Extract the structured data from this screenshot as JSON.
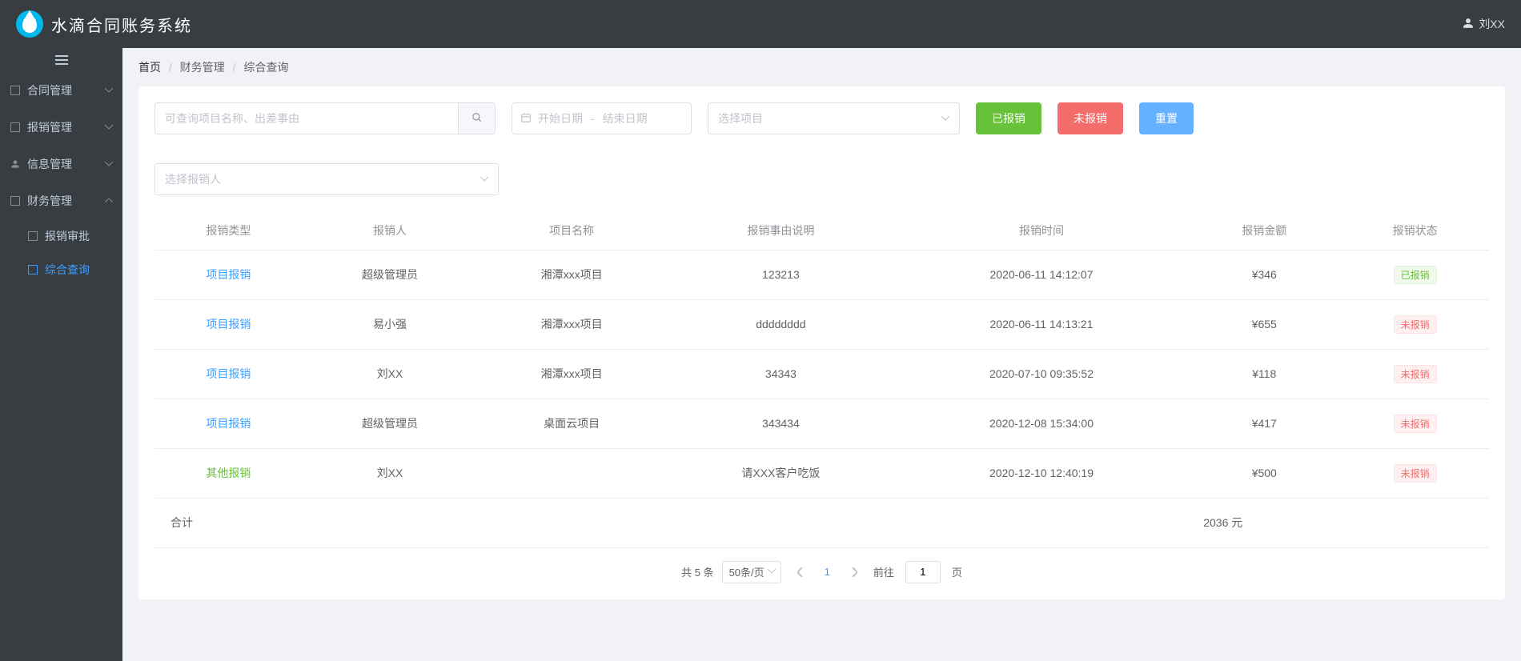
{
  "header": {
    "appTitle": "水滴合同账务系统",
    "userName": "刘XX"
  },
  "sidebar": {
    "items": [
      {
        "label": "合同管理"
      },
      {
        "label": "报销管理"
      },
      {
        "label": "信息管理"
      },
      {
        "label": "财务管理"
      }
    ],
    "subItems": [
      {
        "label": "报销审批"
      },
      {
        "label": "综合查询"
      }
    ]
  },
  "breadcrumb": {
    "home": "首页",
    "mid": "财务管理",
    "last": "综合查询"
  },
  "filters": {
    "searchPlaceholder": "可查询项目名称、出差事由",
    "dateStart": "开始日期",
    "dateEnd": "结束日期",
    "projectPlaceholder": "选择项目",
    "reporterPlaceholder": "选择报销人",
    "btnReported": "已报销",
    "btnUnreported": "未报销",
    "btnReset": "重置"
  },
  "table": {
    "headers": [
      "报销类型",
      "报销人",
      "项目名称",
      "报销事由说明",
      "报销时间",
      "报销金额",
      "报销状态"
    ],
    "rows": [
      {
        "type": "项目报销",
        "typeClass": "link-blue",
        "person": "超级管理员",
        "project": "湘潭xxx项目",
        "reason": "123213",
        "time": "2020-06-11 14:12:07",
        "amount": "¥346",
        "status": "已报销",
        "statusClass": "tag-green"
      },
      {
        "type": "项目报销",
        "typeClass": "link-blue",
        "person": "易小强",
        "project": "湘潭xxx项目",
        "reason": "dddddddd",
        "time": "2020-06-11 14:13:21",
        "amount": "¥655",
        "status": "未报销",
        "statusClass": "tag-red"
      },
      {
        "type": "项目报销",
        "typeClass": "link-blue",
        "person": "刘XX",
        "project": "湘潭xxx项目",
        "reason": "34343",
        "time": "2020-07-10 09:35:52",
        "amount": "¥118",
        "status": "未报销",
        "statusClass": "tag-red"
      },
      {
        "type": "项目报销",
        "typeClass": "link-blue",
        "person": "超级管理员",
        "project": "桌面云项目",
        "reason": "343434",
        "time": "2020-12-08 15:34:00",
        "amount": "¥417",
        "status": "未报销",
        "statusClass": "tag-red"
      },
      {
        "type": "其他报销",
        "typeClass": "link-green",
        "person": "刘XX",
        "project": "",
        "reason": "请XXX客户吃饭",
        "time": "2020-12-10 12:40:19",
        "amount": "¥500",
        "status": "未报销",
        "statusClass": "tag-red"
      }
    ],
    "sumLabel": "合计",
    "sumValue": "2036 元"
  },
  "pagination": {
    "totalText": "共 5 条",
    "pageSize": "50条/页",
    "current": "1",
    "jumpPrefix": "前往",
    "jumpInput": "1",
    "jumpSuffix": "页"
  }
}
